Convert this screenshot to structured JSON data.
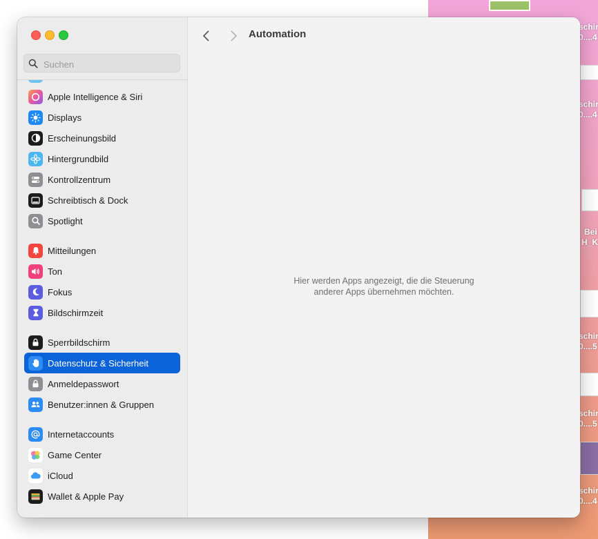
{
  "window": {
    "search": {
      "placeholder": "Suchen"
    },
    "header": {
      "title": "Automation"
    },
    "main": {
      "empty_message_line1": "Hier werden Apps angezeigt, die die Steuerung",
      "empty_message_line2": "anderer Apps übernehmen möchten."
    },
    "sidebar": {
      "items": [
        {
          "label": "Apple Intelligence & Siri",
          "icon": "siri-icon",
          "color": "#e9589a"
        },
        {
          "label": "Displays",
          "icon": "sun-icon",
          "color": "#1e88f5"
        },
        {
          "label": "Erscheinungsbild",
          "icon": "appearance-icon",
          "color": "#1c1c1c"
        },
        {
          "label": "Hintergrundbild",
          "icon": "flower-icon",
          "color": "#4cb7ee"
        },
        {
          "label": "Kontrollzentrum",
          "icon": "toggles-icon",
          "color": "#8e8e93"
        },
        {
          "label": "Schreibtisch & Dock",
          "icon": "dock-icon",
          "color": "#1c1c1c"
        },
        {
          "label": "Spotlight",
          "icon": "magnifier-icon",
          "color": "#8e8e93"
        },
        {
          "label": "Mitteilungen",
          "icon": "bell-icon",
          "color": "#f2463f"
        },
        {
          "label": "Ton",
          "icon": "speaker-icon",
          "color": "#f2407a"
        },
        {
          "label": "Fokus",
          "icon": "moon-icon",
          "color": "#5c5ce0"
        },
        {
          "label": "Bildschirmzeit",
          "icon": "hourglass-icon",
          "color": "#5c5ce0"
        },
        {
          "label": "Sperrbildschirm",
          "icon": "lock-icon",
          "color": "#1c1c1c"
        },
        {
          "label": "Datenschutz & Sicherheit",
          "icon": "hand-icon",
          "color": "#2c8cf3"
        },
        {
          "label": "Anmeldepasswort",
          "icon": "padlock-icon",
          "color": "#8e8e93"
        },
        {
          "label": "Benutzer:innen & Gruppen",
          "icon": "users-icon",
          "color": "#2c8cf3"
        },
        {
          "label": "Internetaccounts",
          "icon": "at-icon",
          "color": "#2c8cf3"
        },
        {
          "label": "Game Center",
          "icon": "gamecenter-icon",
          "color": "#ffffff"
        },
        {
          "label": "iCloud",
          "icon": "cloud-icon",
          "color": "#ffffff"
        },
        {
          "label": "Wallet & Apple Pay",
          "icon": "wallet-icon",
          "color": "#1c1c1c"
        }
      ],
      "selected": "Datenschutz & Sicherheit"
    }
  },
  "desktop": {
    "labels": [
      "schir",
      "0....4",
      "schir",
      "0....4",
      "Bei",
      "H_K.",
      "schir",
      "0....5",
      "schir",
      "0....5",
      "schir",
      "0....4"
    ]
  }
}
